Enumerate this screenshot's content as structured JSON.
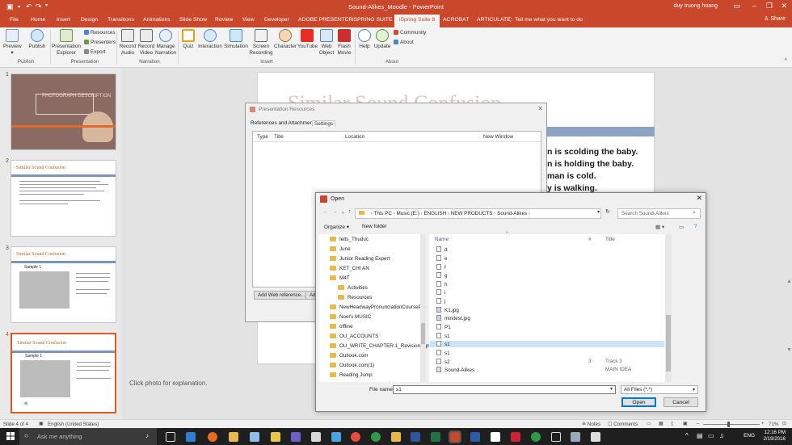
{
  "titlebar": {
    "title": "Sound-Alikes_Moodle - PowerPoint",
    "user": "duy truong hoang"
  },
  "tabs": [
    "File",
    "Home",
    "Insert",
    "Design",
    "Transitions",
    "Animations",
    "Slide Show",
    "Review",
    "View",
    "Developer",
    "ADOBE PRESENTER",
    "iSPRING SUITE 7",
    "iSpring Suite 8",
    "ACROBAT",
    "ARTICULATE"
  ],
  "active_tab": "iSpring Suite 8",
  "tell_me": "Tell me what you want to do",
  "share": "Share",
  "ribbon": {
    "preview": "Preview",
    "publish": "Publish",
    "presentation_explorer": "Presentation Explorer",
    "resources": "Resources",
    "presenters": "Presenters",
    "export": "Export",
    "record_audio": "Record Audio",
    "record_video": "Record Video",
    "manage_narration": "Manage Narration",
    "quiz": "Quiz",
    "interaction": "Interaction",
    "simulation": "Simulation",
    "screen_recording": "Screen Recording",
    "character": "Character",
    "youtube": "YouTube",
    "web_object": "Web Object",
    "flash_movie": "Flash Movie",
    "help": "Help",
    "update": "Update",
    "community": "Community",
    "about_btn": "About",
    "groups": {
      "publish": "Publish",
      "presentation": "Presentation",
      "narration": "Narration",
      "insert": "Insert",
      "about": "About"
    }
  },
  "slides": [
    {
      "num": "1",
      "title": "PHOTOGRAPH DESCRIPTION"
    },
    {
      "num": "2",
      "title": "Similar Sound Confusion"
    },
    {
      "num": "3",
      "title": "Similar Sound Confusion",
      "sub": "Sample 1"
    },
    {
      "num": "4",
      "title": "Similar Sound Confusion",
      "sub": "Sample 1"
    }
  ],
  "slide": {
    "title": "Similar Sound Confusion",
    "lines": [
      "n is scolding the baby.",
      "n is holding the baby.",
      "man is cold.",
      "y is walking."
    ]
  },
  "notes_placeholder": "Click photo for explanation.",
  "pres_dialog": {
    "title": "Presentation Resources",
    "tabs": [
      "References and Attachments",
      "Settings"
    ],
    "columns": [
      "Type",
      "Title",
      "Location",
      "New Window"
    ],
    "add_web": "Add Web reference...",
    "add2": "Add"
  },
  "open_dialog": {
    "title": "Open",
    "path": [
      "This PC",
      "Music (E:)",
      "ENGLISH",
      "NEW PRODUCTS",
      "Sound-Alikes"
    ],
    "search_placeholder": "Search Sound-Alikes",
    "organize": "Organize",
    "new_folder": "New folder",
    "folders": [
      "Ielts_Thuduc",
      "June",
      "Junior Reading Expert",
      "KET_CHI AN",
      "M4T",
      "Activities",
      "Resources",
      "NewHeadwayPronunciationCoursePre",
      "Noel's MUSIC",
      "offline",
      "OU_ACCOUNTS",
      "OU_WRITE_CHAPTER-1_Revision-Cpt",
      "Outlook.com",
      "Outlook.com(1)",
      "Reading Jump"
    ],
    "columns": {
      "name": "Name",
      "num": "#",
      "title": "Title"
    },
    "files": [
      {
        "name": "d",
        "num": "",
        "title": ""
      },
      {
        "name": "e",
        "num": "",
        "title": ""
      },
      {
        "name": "f",
        "num": "",
        "title": ""
      },
      {
        "name": "g",
        "num": "",
        "title": ""
      },
      {
        "name": "h",
        "num": "",
        "title": ""
      },
      {
        "name": "i",
        "num": "",
        "title": ""
      },
      {
        "name": "j",
        "num": "",
        "title": ""
      },
      {
        "name": "K1.jpg",
        "num": "",
        "title": ""
      },
      {
        "name": "minitest.jpg",
        "num": "",
        "title": ""
      },
      {
        "name": "P1",
        "num": "",
        "title": ""
      },
      {
        "name": "s1",
        "num": "",
        "title": ""
      },
      {
        "name": "s1",
        "num": "",
        "title": ""
      },
      {
        "name": "s1",
        "num": "",
        "title": ""
      },
      {
        "name": "s2",
        "num": "3",
        "title": "Track 3"
      },
      {
        "name": "Sound-Alikes",
        "num": "",
        "title": "MAIN IDEA"
      }
    ],
    "file_name_label": "File name:",
    "file_name": "s1",
    "file_type": "All Files (*.*)",
    "open": "Open",
    "cancel": "Cancel"
  },
  "status": {
    "slide": "Slide 4 of 4",
    "language": "English (United States)",
    "notes": "Notes",
    "comments": "Comments",
    "zoom": "71%"
  },
  "taskbar": {
    "search": "Ask me anything",
    "lang": "ENG",
    "time": "12:16 PM",
    "date": "2/19/2016"
  },
  "colors": {
    "accent": "#c9472b",
    "selected": "#cce4f7",
    "folder": "#e8b84a"
  }
}
